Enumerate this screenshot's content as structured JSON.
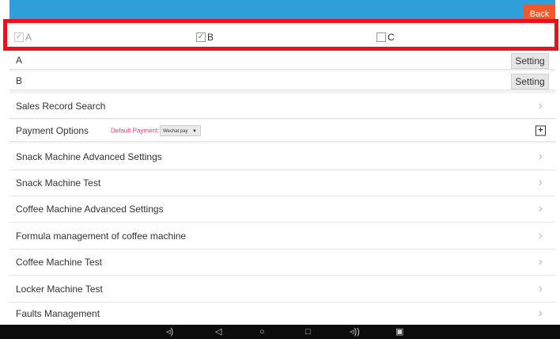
{
  "header": {
    "back_label": "Back"
  },
  "checkboxes": [
    {
      "label": "A",
      "checked": true,
      "disabled": true
    },
    {
      "label": "B",
      "checked": true,
      "disabled": false
    },
    {
      "label": "C",
      "checked": false,
      "disabled": false
    }
  ],
  "settings_rows": [
    {
      "label": "A",
      "button": "Setting"
    },
    {
      "label": "B",
      "button": "Setting"
    }
  ],
  "menu": {
    "sales_record": "Sales Record Search",
    "payment_options": "Payment Options",
    "default_payment_label": "Default Payment:",
    "default_payment_value": "Wechat pay",
    "snack_advanced": "Snack Machine Advanced Settings",
    "snack_test": "Snack Machine Test",
    "coffee_advanced": "Coffee Machine Advanced Settings",
    "formula_management": "Formula management of coffee machine",
    "coffee_test": "Coffee Machine Test",
    "locker_test": "Locker Machine Test",
    "faults_management": "Faults Management"
  },
  "icons": {
    "chevron": "chevron-right-icon",
    "plus": "plus-box-icon",
    "check": "check-icon"
  },
  "colors": {
    "topbar": "#2e9fd8",
    "back_button": "#f05a2a",
    "highlight_frame": "#e8131a",
    "payment_label": "#e23a7a"
  }
}
